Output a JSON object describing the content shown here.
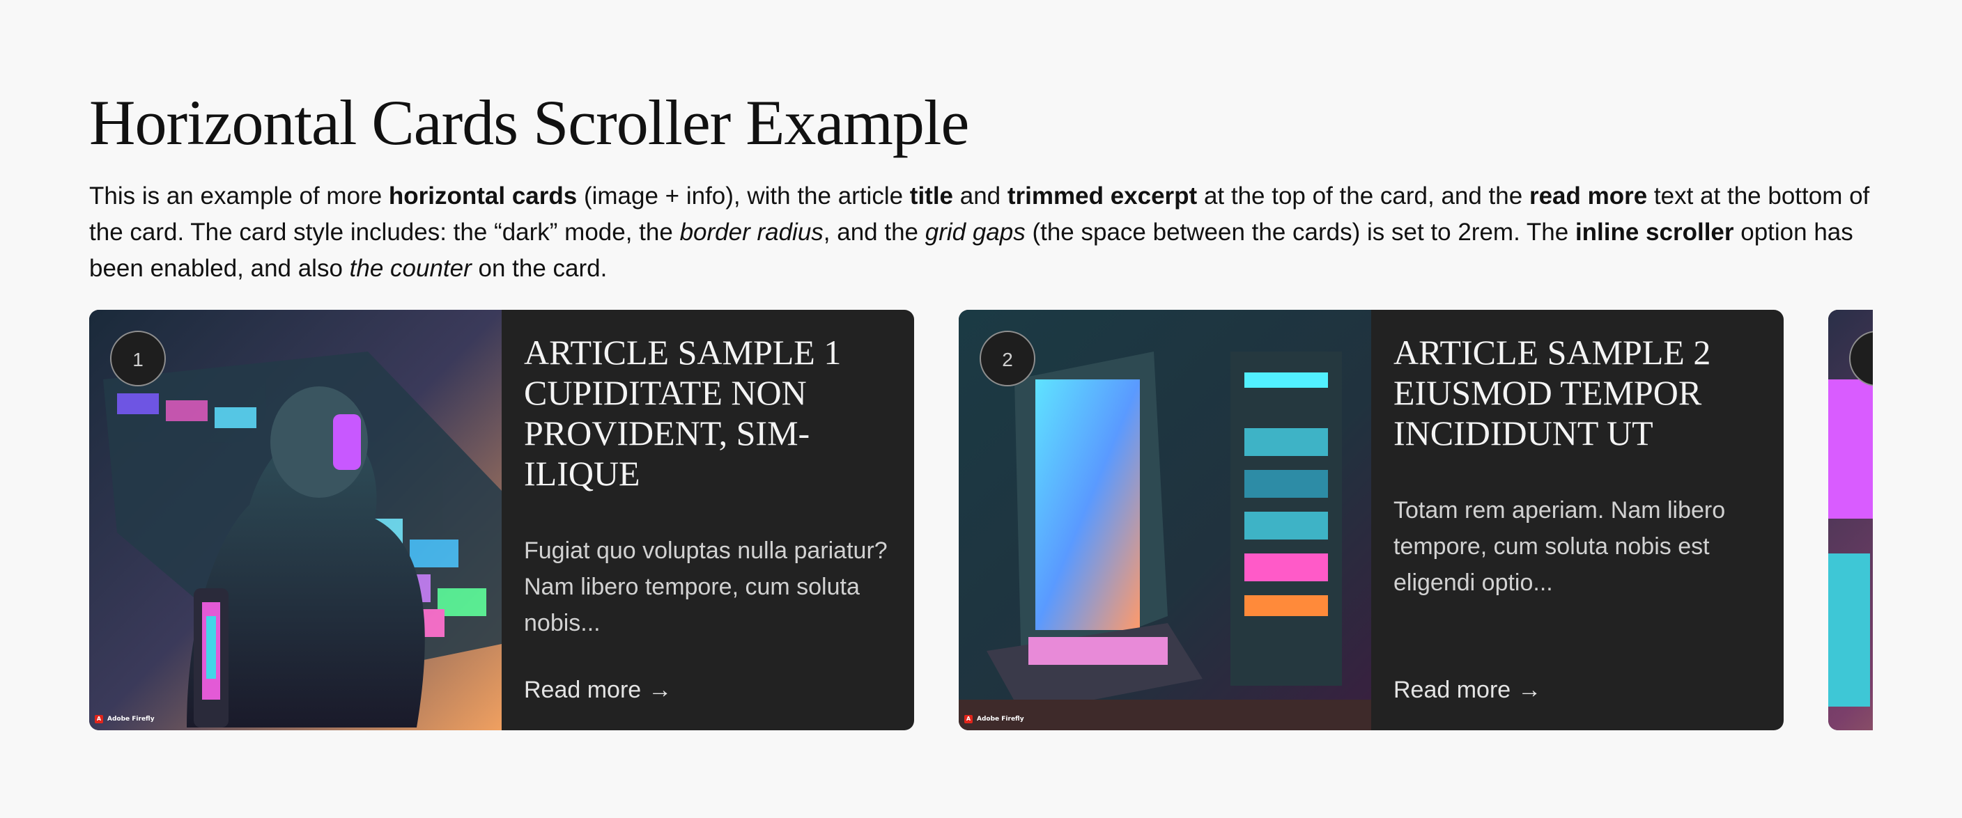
{
  "page": {
    "title": "Horizontal Cards Scroller Example",
    "intro": [
      {
        "text": "This is an example of more ",
        "style": "normal"
      },
      {
        "text": "horizontal cards",
        "style": "bold"
      },
      {
        "text": " (image + info), with the article ",
        "style": "normal"
      },
      {
        "text": "title",
        "style": "bold"
      },
      {
        "text": " and ",
        "style": "normal"
      },
      {
        "text": "trimmed excerpt",
        "style": "bold"
      },
      {
        "text": " at the top of the card, and the ",
        "style": "normal"
      },
      {
        "text": "read more",
        "style": "bold"
      },
      {
        "text": " text at the bottom of the card. The card style includes: the “dark” mode, the ",
        "style": "normal"
      },
      {
        "text": "border radius",
        "style": "italic"
      },
      {
        "text": ", and the ",
        "style": "normal"
      },
      {
        "text": "grid gaps",
        "style": "italic"
      },
      {
        "text": " (the space between the cards) is set to 2rem. The ",
        "style": "normal"
      },
      {
        "text": "inline scroller",
        "style": "bold"
      },
      {
        "text": " option has been enabled, and also ",
        "style": "normal"
      },
      {
        "text": "the counter",
        "style": "italic"
      },
      {
        "text": " on the card.",
        "style": "normal"
      }
    ]
  },
  "cards": [
    {
      "counter": "1",
      "title": "ARTICLE SAMPLE 1 CUPIDITATE NON PROVIDENT, SIM-ILIQUE",
      "excerpt": "Fugiat quo voluptas nulla pariatur? Nam libero tempore, cum soluta nobis...",
      "read_more": "Read more",
      "image_badge": "Adobe Firefly",
      "icon": "arrow-right-icon"
    },
    {
      "counter": "2",
      "title": "ARTICLE SAMPLE 2 EIUSMOD TEMPOR INCIDIDUNT UT",
      "excerpt": "Totam rem aperiam. Nam libero tempore, cum soluta nobis est eligendi optio...",
      "read_more": "Read more",
      "image_badge": "Adobe Firefly",
      "icon": "arrow-right-icon"
    }
  ],
  "colors": {
    "page_bg": "#f8f8f8",
    "card_bg": "#222222",
    "text_dark": "#111111",
    "text_light": "#f0f0f0"
  }
}
